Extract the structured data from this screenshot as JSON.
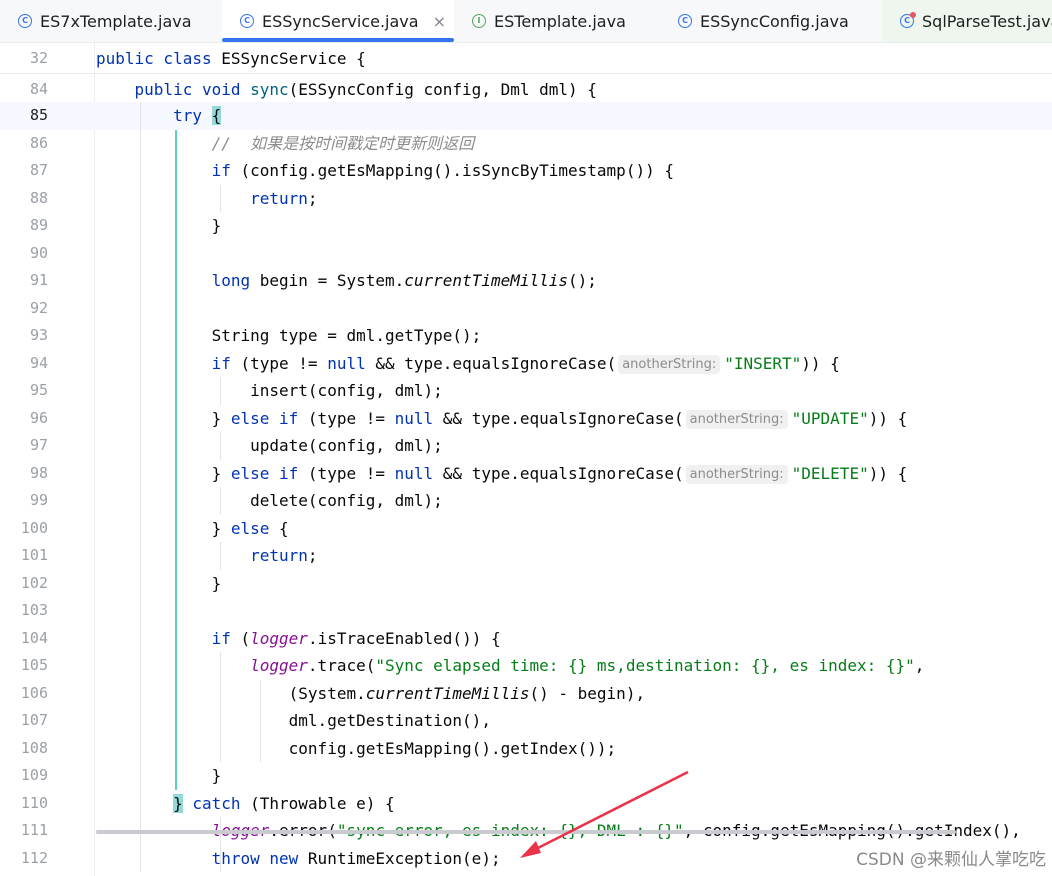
{
  "tabs": [
    {
      "label": "ES7xTemplate.java",
      "icon": "class-icon"
    },
    {
      "label": "ESSyncService.java",
      "icon": "class-icon",
      "active": true,
      "close": "×"
    },
    {
      "label": "ESTemplate.java",
      "icon": "interface-icon"
    },
    {
      "label": "ESSyncConfig.java",
      "icon": "class-icon"
    },
    {
      "label": "SqlParseTest.java",
      "icon": "test-class-icon"
    }
  ],
  "colors": {
    "accent": "#3574f0",
    "keyword": "#0033b3",
    "string": "#067d17",
    "comment": "#8c8c8c",
    "field": "#871094",
    "arrow": "#e8334a"
  },
  "code": {
    "sticky": [
      {
        "num": "32",
        "tokens": [
          {
            "t": "public class ",
            "k": "kw"
          },
          {
            "t": "ESSyncService {"
          }
        ]
      },
      {
        "num": "84",
        "tokens": [
          {
            "t": "    "
          },
          {
            "t": "public void ",
            "k": "kw"
          },
          {
            "t": "sync",
            "k": "mth"
          },
          {
            "t": "(ESSyncConfig config, Dml dml) {"
          }
        ]
      }
    ],
    "lines": [
      {
        "num": "85",
        "caret": true,
        "tokens": [
          {
            "t": "        "
          },
          {
            "t": "try ",
            "k": "kw"
          },
          {
            "t": "{",
            "k": "brace"
          }
        ]
      },
      {
        "num": "86",
        "tokens": [
          {
            "t": "            "
          },
          {
            "t": "//  如果是按时间戳定时更新则返回",
            "k": "cmt"
          }
        ]
      },
      {
        "num": "87",
        "tokens": [
          {
            "t": "            "
          },
          {
            "t": "if ",
            "k": "kw"
          },
          {
            "t": "(config.getEsMapping().isSyncByTimestamp()) {"
          }
        ]
      },
      {
        "num": "88",
        "tokens": [
          {
            "t": "                "
          },
          {
            "t": "return",
            "k": "kw"
          },
          {
            "t": ";"
          }
        ]
      },
      {
        "num": "89",
        "tokens": [
          {
            "t": "            }"
          }
        ]
      },
      {
        "num": "90",
        "tokens": []
      },
      {
        "num": "91",
        "tokens": [
          {
            "t": "            "
          },
          {
            "t": "long ",
            "k": "kw"
          },
          {
            "t": "begin = System."
          },
          {
            "t": "currentTimeMillis",
            "k": "it"
          },
          {
            "t": "();"
          }
        ]
      },
      {
        "num": "92",
        "tokens": []
      },
      {
        "num": "93",
        "tokens": [
          {
            "t": "            String type = dml.getType();"
          }
        ]
      },
      {
        "num": "94",
        "tokens": [
          {
            "t": "            "
          },
          {
            "t": "if ",
            "k": "kw"
          },
          {
            "t": "(type != "
          },
          {
            "t": "null ",
            "k": "kw"
          },
          {
            "t": "&& type.equalsIgnoreCase("
          },
          {
            "t": "anotherString:",
            "k": "hint"
          },
          {
            "t": "\"INSERT\"",
            "k": "str"
          },
          {
            "t": ")) {"
          }
        ]
      },
      {
        "num": "95",
        "tokens": [
          {
            "t": "                insert(config, dml);"
          }
        ]
      },
      {
        "num": "96",
        "tokens": [
          {
            "t": "            } "
          },
          {
            "t": "else if ",
            "k": "kw"
          },
          {
            "t": "(type != "
          },
          {
            "t": "null ",
            "k": "kw"
          },
          {
            "t": "&& type.equalsIgnoreCase("
          },
          {
            "t": "anotherString:",
            "k": "hint"
          },
          {
            "t": "\"UPDATE\"",
            "k": "str"
          },
          {
            "t": ")) {"
          }
        ]
      },
      {
        "num": "97",
        "tokens": [
          {
            "t": "                update(config, dml);"
          }
        ]
      },
      {
        "num": "98",
        "tokens": [
          {
            "t": "            } "
          },
          {
            "t": "else if ",
            "k": "kw"
          },
          {
            "t": "(type != "
          },
          {
            "t": "null ",
            "k": "kw"
          },
          {
            "t": "&& type.equalsIgnoreCase("
          },
          {
            "t": "anotherString:",
            "k": "hint"
          },
          {
            "t": "\"DELETE\"",
            "k": "str"
          },
          {
            "t": ")) {"
          }
        ]
      },
      {
        "num": "99",
        "tokens": [
          {
            "t": "                delete(config, dml);"
          }
        ]
      },
      {
        "num": "100",
        "tokens": [
          {
            "t": "            } "
          },
          {
            "t": "else ",
            "k": "kw"
          },
          {
            "t": "{"
          }
        ]
      },
      {
        "num": "101",
        "tokens": [
          {
            "t": "                "
          },
          {
            "t": "return",
            "k": "kw"
          },
          {
            "t": ";"
          }
        ]
      },
      {
        "num": "102",
        "tokens": [
          {
            "t": "            }"
          }
        ]
      },
      {
        "num": "103",
        "tokens": []
      },
      {
        "num": "104",
        "tokens": [
          {
            "t": "            "
          },
          {
            "t": "if ",
            "k": "kw"
          },
          {
            "t": "("
          },
          {
            "t": "logger",
            "k": "fld"
          },
          {
            "t": ".isTraceEnabled()) {"
          }
        ]
      },
      {
        "num": "105",
        "tokens": [
          {
            "t": "                "
          },
          {
            "t": "logger",
            "k": "fld"
          },
          {
            "t": ".trace("
          },
          {
            "t": "\"Sync elapsed time: {} ms,destination: {}, es index: {}\"",
            "k": "str"
          },
          {
            "t": ","
          }
        ]
      },
      {
        "num": "106",
        "tokens": [
          {
            "t": "                    (System."
          },
          {
            "t": "currentTimeMillis",
            "k": "it"
          },
          {
            "t": "() - begin),"
          }
        ]
      },
      {
        "num": "107",
        "tokens": [
          {
            "t": "                    dml.getDestination(),"
          }
        ]
      },
      {
        "num": "108",
        "tokens": [
          {
            "t": "                    config.getEsMapping().getIndex());"
          }
        ]
      },
      {
        "num": "109",
        "tokens": [
          {
            "t": "            }"
          }
        ]
      },
      {
        "num": "110",
        "tokens": [
          {
            "t": "        "
          },
          {
            "t": "}",
            "k": "brace"
          },
          {
            "t": " "
          },
          {
            "t": "catch ",
            "k": "kw"
          },
          {
            "t": "(Throwable e) {"
          }
        ]
      },
      {
        "num": "111",
        "tokens": [
          {
            "t": "            "
          },
          {
            "t": "logger",
            "k": "fld"
          },
          {
            "t": ".error("
          },
          {
            "t": "\"sync error, es index: {}, DML : {}\"",
            "k": "str"
          },
          {
            "t": ", config.getEsMapping().getIndex(),"
          }
        ]
      },
      {
        "num": "112",
        "tokens": [
          {
            "t": "            "
          },
          {
            "t": "throw new ",
            "k": "kw"
          },
          {
            "t": "RuntimeException(e);"
          }
        ]
      }
    ]
  },
  "watermark": "CSDN @来颗仙人掌吃吃"
}
